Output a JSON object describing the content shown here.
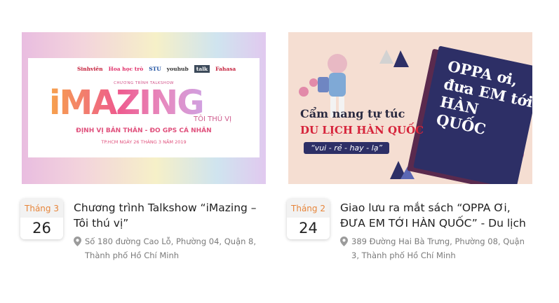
{
  "events": [
    {
      "month": "Tháng 3",
      "day": "26",
      "title": "Chương trình Talkshow “iMazing – Tôi thú vị”",
      "address": "Số 180 đường Cao Lỗ, Phường 04, Quận 8, Thành phố Hồ Chí Minh",
      "banner": {
        "logos": [
          "Sinhviên",
          "Hoa học trò",
          "STU",
          "youhub",
          "talk",
          "Fahasa"
        ],
        "subtitle": "CHƯƠNG TRÌNH TALKSHOW",
        "headline": "iMAZING",
        "tagline": "TÔI THÚ VỊ",
        "line": "ĐỊNH VỊ BẢN THÂN - ĐO GPS CÁ NHÂN",
        "date_line": "TP.HCM NGÀY 26 THÁNG 3 NĂM 2019"
      }
    },
    {
      "month": "Tháng 2",
      "day": "24",
      "title": "Giao lưu ra mắt sách “OPPA Ơi, ĐƯA EM TỚI HÀN QUỐC” - Du lịch",
      "address": "389 Đường Hai Bà Trưng, Phường 08, Quận 3, Thành phố Hồ Chí Minh",
      "banner": {
        "heading1": "Cẩm nang tự túc",
        "heading2": "DU LỊCH HÀN QUỐC",
        "slogan": "“vui - rẻ - hay - lạ”",
        "book_title": "OPPA ơi, đưa EM tới HÀN QUỐC"
      }
    }
  ],
  "colors": {
    "month_text": "#e7853a",
    "pin": "#9b9b9b"
  }
}
